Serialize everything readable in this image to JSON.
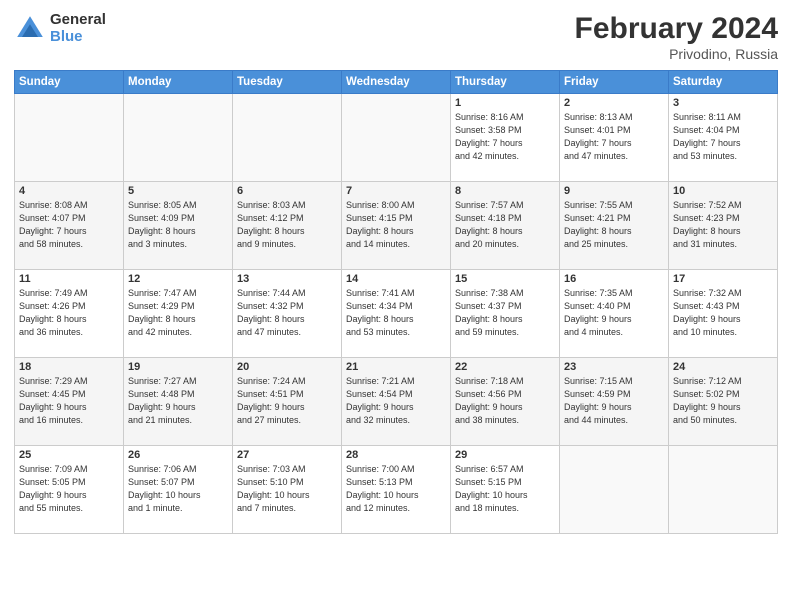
{
  "header": {
    "logo_general": "General",
    "logo_blue": "Blue",
    "title": "February 2024",
    "subtitle": "Privodino, Russia"
  },
  "days_of_week": [
    "Sunday",
    "Monday",
    "Tuesday",
    "Wednesday",
    "Thursday",
    "Friday",
    "Saturday"
  ],
  "weeks": [
    [
      {
        "day": "",
        "info": ""
      },
      {
        "day": "",
        "info": ""
      },
      {
        "day": "",
        "info": ""
      },
      {
        "day": "",
        "info": ""
      },
      {
        "day": "1",
        "info": "Sunrise: 8:16 AM\nSunset: 3:58 PM\nDaylight: 7 hours\nand 42 minutes."
      },
      {
        "day": "2",
        "info": "Sunrise: 8:13 AM\nSunset: 4:01 PM\nDaylight: 7 hours\nand 47 minutes."
      },
      {
        "day": "3",
        "info": "Sunrise: 8:11 AM\nSunset: 4:04 PM\nDaylight: 7 hours\nand 53 minutes."
      }
    ],
    [
      {
        "day": "4",
        "info": "Sunrise: 8:08 AM\nSunset: 4:07 PM\nDaylight: 7 hours\nand 58 minutes."
      },
      {
        "day": "5",
        "info": "Sunrise: 8:05 AM\nSunset: 4:09 PM\nDaylight: 8 hours\nand 3 minutes."
      },
      {
        "day": "6",
        "info": "Sunrise: 8:03 AM\nSunset: 4:12 PM\nDaylight: 8 hours\nand 9 minutes."
      },
      {
        "day": "7",
        "info": "Sunrise: 8:00 AM\nSunset: 4:15 PM\nDaylight: 8 hours\nand 14 minutes."
      },
      {
        "day": "8",
        "info": "Sunrise: 7:57 AM\nSunset: 4:18 PM\nDaylight: 8 hours\nand 20 minutes."
      },
      {
        "day": "9",
        "info": "Sunrise: 7:55 AM\nSunset: 4:21 PM\nDaylight: 8 hours\nand 25 minutes."
      },
      {
        "day": "10",
        "info": "Sunrise: 7:52 AM\nSunset: 4:23 PM\nDaylight: 8 hours\nand 31 minutes."
      }
    ],
    [
      {
        "day": "11",
        "info": "Sunrise: 7:49 AM\nSunset: 4:26 PM\nDaylight: 8 hours\nand 36 minutes."
      },
      {
        "day": "12",
        "info": "Sunrise: 7:47 AM\nSunset: 4:29 PM\nDaylight: 8 hours\nand 42 minutes."
      },
      {
        "day": "13",
        "info": "Sunrise: 7:44 AM\nSunset: 4:32 PM\nDaylight: 8 hours\nand 47 minutes."
      },
      {
        "day": "14",
        "info": "Sunrise: 7:41 AM\nSunset: 4:34 PM\nDaylight: 8 hours\nand 53 minutes."
      },
      {
        "day": "15",
        "info": "Sunrise: 7:38 AM\nSunset: 4:37 PM\nDaylight: 8 hours\nand 59 minutes."
      },
      {
        "day": "16",
        "info": "Sunrise: 7:35 AM\nSunset: 4:40 PM\nDaylight: 9 hours\nand 4 minutes."
      },
      {
        "day": "17",
        "info": "Sunrise: 7:32 AM\nSunset: 4:43 PM\nDaylight: 9 hours\nand 10 minutes."
      }
    ],
    [
      {
        "day": "18",
        "info": "Sunrise: 7:29 AM\nSunset: 4:45 PM\nDaylight: 9 hours\nand 16 minutes."
      },
      {
        "day": "19",
        "info": "Sunrise: 7:27 AM\nSunset: 4:48 PM\nDaylight: 9 hours\nand 21 minutes."
      },
      {
        "day": "20",
        "info": "Sunrise: 7:24 AM\nSunset: 4:51 PM\nDaylight: 9 hours\nand 27 minutes."
      },
      {
        "day": "21",
        "info": "Sunrise: 7:21 AM\nSunset: 4:54 PM\nDaylight: 9 hours\nand 32 minutes."
      },
      {
        "day": "22",
        "info": "Sunrise: 7:18 AM\nSunset: 4:56 PM\nDaylight: 9 hours\nand 38 minutes."
      },
      {
        "day": "23",
        "info": "Sunrise: 7:15 AM\nSunset: 4:59 PM\nDaylight: 9 hours\nand 44 minutes."
      },
      {
        "day": "24",
        "info": "Sunrise: 7:12 AM\nSunset: 5:02 PM\nDaylight: 9 hours\nand 50 minutes."
      }
    ],
    [
      {
        "day": "25",
        "info": "Sunrise: 7:09 AM\nSunset: 5:05 PM\nDaylight: 9 hours\nand 55 minutes."
      },
      {
        "day": "26",
        "info": "Sunrise: 7:06 AM\nSunset: 5:07 PM\nDaylight: 10 hours\nand 1 minute."
      },
      {
        "day": "27",
        "info": "Sunrise: 7:03 AM\nSunset: 5:10 PM\nDaylight: 10 hours\nand 7 minutes."
      },
      {
        "day": "28",
        "info": "Sunrise: 7:00 AM\nSunset: 5:13 PM\nDaylight: 10 hours\nand 12 minutes."
      },
      {
        "day": "29",
        "info": "Sunrise: 6:57 AM\nSunset: 5:15 PM\nDaylight: 10 hours\nand 18 minutes."
      },
      {
        "day": "",
        "info": ""
      },
      {
        "day": "",
        "info": ""
      }
    ]
  ]
}
